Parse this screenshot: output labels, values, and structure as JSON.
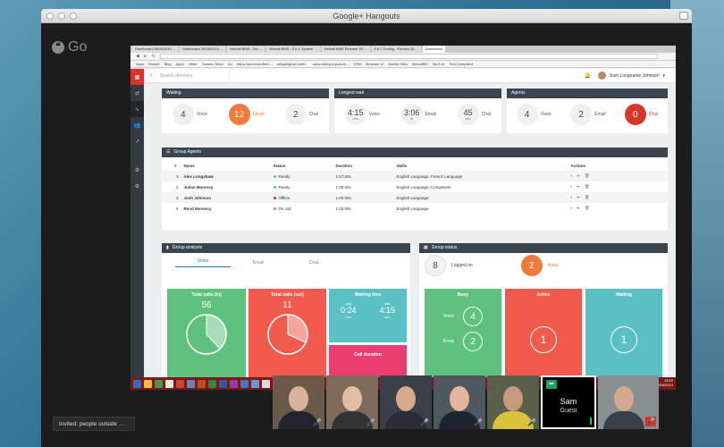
{
  "window": {
    "title": "Google+ Hangouts"
  },
  "hangout": {
    "logo_text": "Go"
  },
  "browser": {
    "tabs": [
      "Dashboard 25/06/2014 ...",
      "Dashboard 25/06/2014 ...",
      "Netcall BMS - Sm ...",
      "Netcall BMS - 5.6.1 System ...",
      "Netcall BMS Release 00 ...",
      "5.6.1 Tooling - Forums (f) ...",
      "Dashboard"
    ],
    "bookmarks": [
      "Apps",
      "Rocket",
      "Bing",
      "Apps",
      "Other",
      "Tomato Timer",
      "Au",
      "https://accessauthen...",
      "netgaingloal.com/...",
      "www.salary.exposure...",
      "CRM",
      "Browser UI",
      "Mobile Sites",
      "NetcallBS",
      "SkoT-fo",
      "Test Compliant"
    ]
  },
  "sidebar": {
    "items": [
      {
        "icon": "grid-icon"
      },
      {
        "icon": "arrows-icon"
      },
      {
        "icon": "pulse-icon"
      },
      {
        "icon": "users-icon"
      },
      {
        "icon": "chart-icon"
      },
      {
        "icon": "gear-icon"
      },
      {
        "icon": "gear-icon"
      }
    ]
  },
  "topbar": {
    "search_placeholder": "Search directory",
    "user_name": "Josh Longname Johnson"
  },
  "waiting": {
    "title": "Waiting",
    "voice": {
      "value": "4",
      "label": "Voice"
    },
    "email": {
      "value": "12",
      "label": "Email"
    },
    "chat": {
      "value": "2",
      "label": "Chat"
    }
  },
  "longest_wait": {
    "title": "Longest wait",
    "voice": {
      "value": "4:15",
      "unit": "min",
      "label": "Voice"
    },
    "email": {
      "value": "3:06",
      "unit": "hr",
      "label": "Email"
    },
    "chat": {
      "value": "45",
      "unit": "sec",
      "label": "Chat"
    }
  },
  "agents_panel": {
    "title": "Agents",
    "voice": {
      "value": "4",
      "label": "Voice"
    },
    "email": {
      "value": "2",
      "label": "Email"
    },
    "chat": {
      "value": "0",
      "label": "Chat"
    }
  },
  "group_agents": {
    "title": "Group Agents",
    "columns": [
      "#",
      "Name",
      "Status",
      "Duration",
      "Skills",
      "Actions"
    ],
    "rows": [
      {
        "num": "1",
        "name": "Alex Longshaw",
        "status": "Ready",
        "status_color": "#5ec27e",
        "duration": "1:57:20s",
        "skills": "English Language, French Language"
      },
      {
        "num": "2",
        "name": "Julian Morency",
        "status": "Ready",
        "status_color": "#5ec27e",
        "duration": "1:30:40s",
        "skills": "English Language, Complaints"
      },
      {
        "num": "3",
        "name": "Josh Johnson",
        "status": "Offline",
        "status_color": "#d9362b",
        "duration": "1:00:30s",
        "skills": "English Language"
      },
      {
        "num": "4",
        "name": "Rend Morency",
        "status": "On call",
        "status_color": "#f07a3a",
        "duration": "1:32:00s",
        "skills": "English Language"
      }
    ]
  },
  "group_analysis": {
    "title": "Group analysis",
    "tabs": [
      "Voice",
      "Email",
      "Chat"
    ],
    "total_in": {
      "label": "Total calls (in)",
      "value": "56"
    },
    "total_out": {
      "label": "Total calls (out)",
      "value": "11"
    },
    "waiting_time": {
      "label": "Waiting time",
      "avg_label": "avg",
      "avg_value": "0:24",
      "avg_unit": "min",
      "max_label": "max",
      "max_value": "4:15",
      "max_unit": "min"
    },
    "call_duration": {
      "label": "Call duration"
    }
  },
  "group_status": {
    "title": "Group status",
    "logged_on": {
      "value": "8",
      "label": "Logged on"
    },
    "away": {
      "value": "2",
      "label": "Away"
    },
    "busy": {
      "label": "Busy",
      "voice_label": "Voice",
      "voice_value": "4",
      "email_label": "Email",
      "email_value": "2"
    },
    "active": {
      "label": "Active",
      "value": "1"
    },
    "waiting": {
      "label": "Waiting",
      "value": "1"
    }
  },
  "taskbar": {
    "time": "15:20",
    "date": "25/06/2014"
  },
  "participants": {
    "sam": {
      "name": "Sam",
      "role": "Guest"
    }
  },
  "invite_bar": {
    "text": "Invited: people outside ..."
  },
  "colors": {
    "green": "#5ec27e",
    "red": "#f15a4d",
    "orange": "#f07a3a",
    "teal": "#5bc0c4",
    "pink": "#ea3d70",
    "header": "#3b454f"
  }
}
